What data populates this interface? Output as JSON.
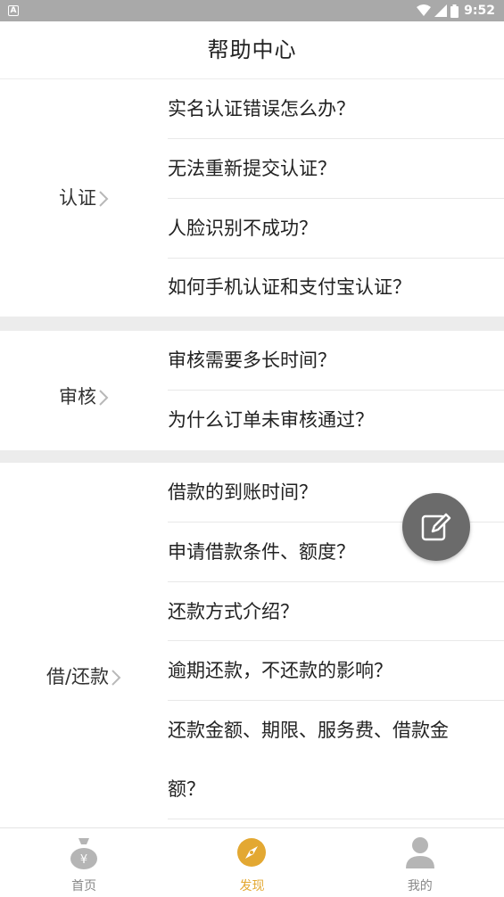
{
  "status_bar": {
    "notification_icon": "a-notification-icon",
    "time": "9:52"
  },
  "header": {
    "title": "帮助中心"
  },
  "sections": [
    {
      "category": "认证",
      "questions": [
        "实名认证错误怎么办？",
        "无法重新提交认证？",
        "人脸识别不成功？",
        "如何手机认证和支付宝认证？"
      ]
    },
    {
      "category": "审核",
      "questions": [
        "审核需要多长时间？",
        "为什么订单未审核通过？"
      ]
    },
    {
      "category": "借/还款",
      "questions": [
        "借款的到账时间？",
        "申请借款条件、额度？",
        "还款方式介绍？",
        "逾期还款，不还款的影响？",
        "还款金额、期限、服务费、借款金",
        "额？"
      ]
    }
  ],
  "fab": {
    "icon": "edit-icon"
  },
  "bottom_nav": [
    {
      "label": "首页",
      "icon": "money-bag-icon",
      "active": false
    },
    {
      "label": "发现",
      "icon": "compass-icon",
      "active": true
    },
    {
      "label": "我的",
      "icon": "user-icon",
      "active": false
    }
  ],
  "colors": {
    "accent": "#e3a832",
    "status_bar": "#a9a9a9",
    "divider_band": "#ececec",
    "fab": "#6b6b6b",
    "inactive_icon": "#b5b5b5"
  }
}
